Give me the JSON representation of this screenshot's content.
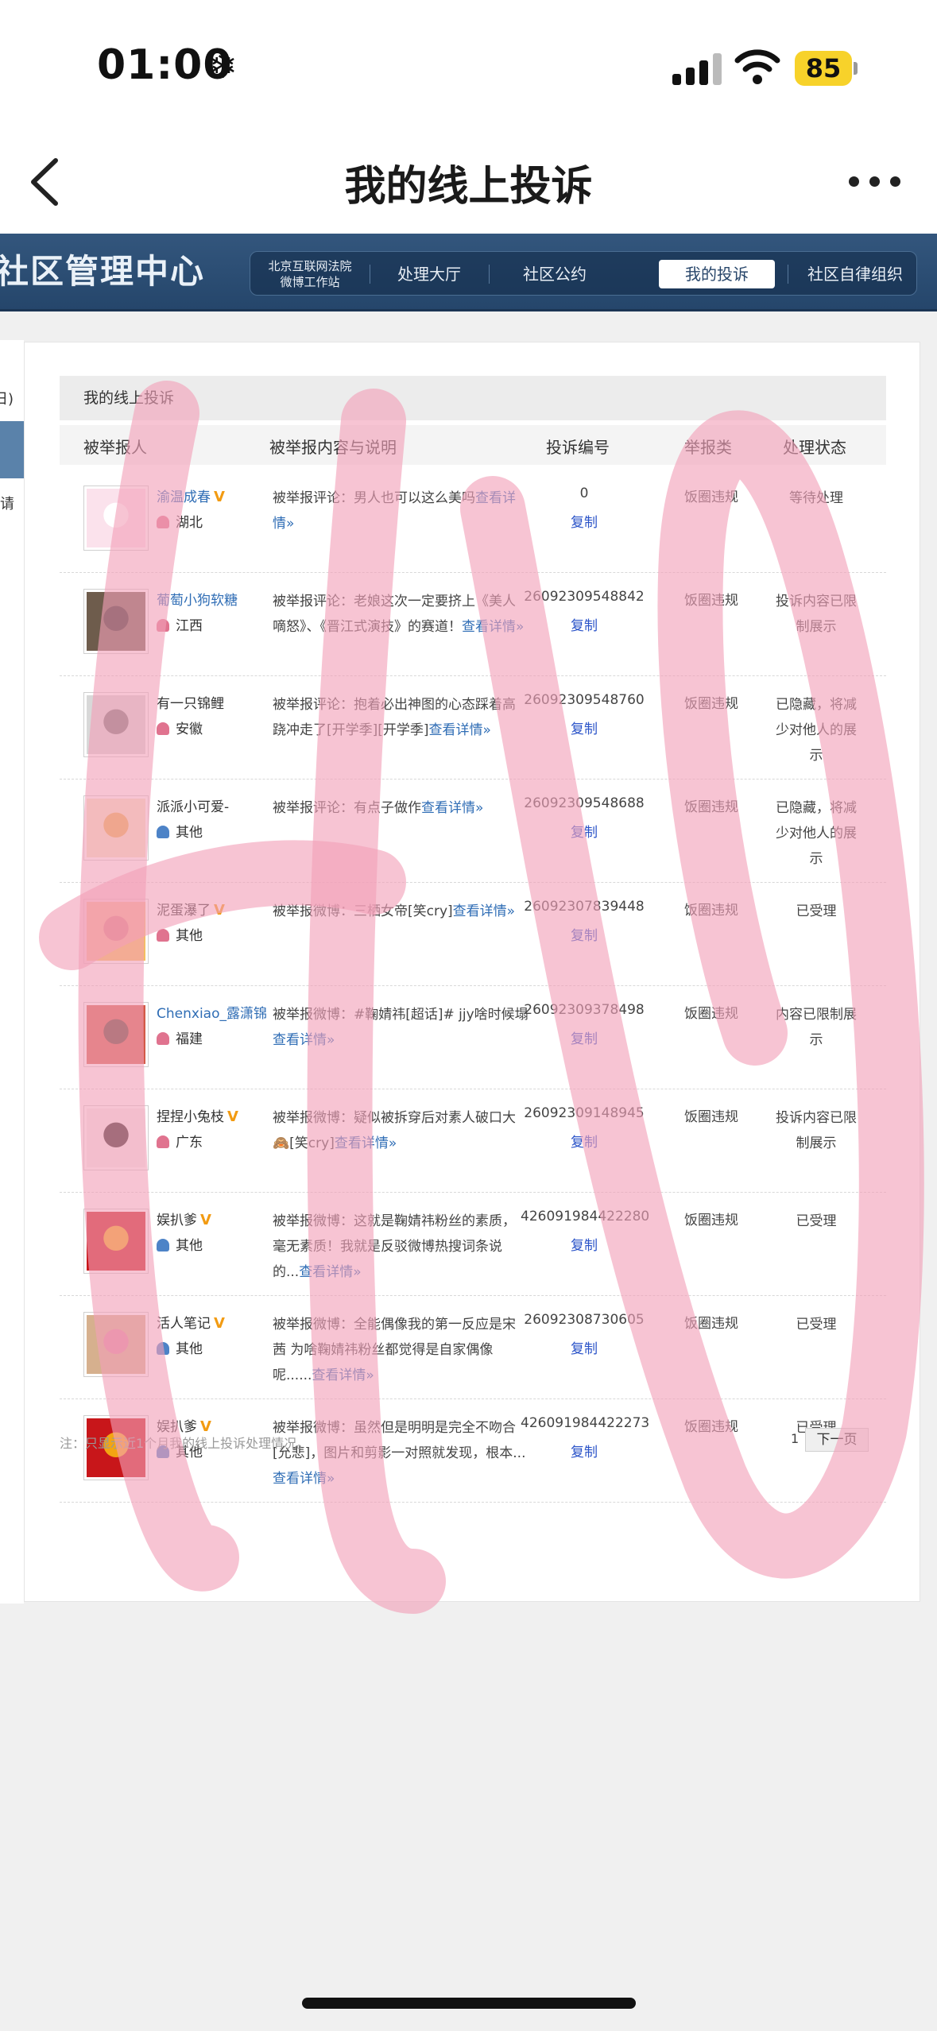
{
  "status": {
    "time": "01:00",
    "battery": "85"
  },
  "nav": {
    "title": "我的线上投诉"
  },
  "header": {
    "site_title": "社区管理中心",
    "tabs": [
      {
        "label_line1": "北京互联网法院",
        "label_line2": "微博工作站"
      },
      {
        "label": "处理大厅"
      },
      {
        "label": "社区公约"
      },
      {
        "label": "我的投诉"
      },
      {
        "label": "社区自律组织"
      }
    ]
  },
  "sidebar": {
    "item1": "日)",
    "item2": "请"
  },
  "panel": {
    "title": "我的线上投诉"
  },
  "table": {
    "headers": [
      "被举报人",
      "被举报内容与说明",
      "投诉编号",
      "举报类",
      "处理状态"
    ],
    "rows": [
      {
        "name": "渝温成春",
        "vip": true,
        "location": "湖北",
        "gender": "female",
        "desc_text": "被举报评论：男人也可以这么美吗",
        "desc_link": "查看详情»",
        "id": "0",
        "copy": "复制",
        "category": "饭圈违规",
        "status": "等待处理"
      },
      {
        "name": "葡萄小狗软糖",
        "vip": false,
        "location": "江西",
        "gender": "female",
        "desc_text": "被举报评论：老娘这次一定要挤上《美人嘀怒》、《晋江式演技》的赛道！",
        "desc_link": "查看详情»",
        "id": "26092309548842",
        "copy": "复制",
        "category": "饭圈违规",
        "status": "投诉内容已限制展示"
      },
      {
        "name": "有一只锦鲤",
        "vip": false,
        "location": "安徽",
        "gender": "female",
        "desc_text": "被举报评论：抱着必出神图的心态踩着高跷冲走了[开学季][开学季]",
        "desc_link": "查看详情»",
        "id": "26092309548760",
        "copy": "复制",
        "category": "饭圈违规",
        "status": "已隐藏，将减少对他人的展示"
      },
      {
        "name": "派派小可爱-",
        "vip": false,
        "location": "其他",
        "gender": "male",
        "desc_text": "被举报评论：有点子做作",
        "desc_link": "查看详情»",
        "id": "26092309548688",
        "copy": "复制",
        "category": "饭圈违规",
        "status": "已隐藏，将减少对他人的展示"
      },
      {
        "name": "泥蛋瀑了",
        "vip": true,
        "location": "其他",
        "gender": "female",
        "desc_text": "被举报微博：三栖女帝[笑cry]",
        "desc_link": "查看详情»",
        "id": "26092307839448",
        "copy": "复制",
        "category": "饭圈违规",
        "status": "已受理"
      },
      {
        "name": "Chenxiao_露潇锦",
        "vip": false,
        "location": "福建",
        "gender": "female",
        "desc_text": "被举报微博：#鞠婧祎[超话]# jjy啥时候塌",
        "desc_link": "查看详情»",
        "id": "26092309378498",
        "copy": "复制",
        "category": "饭圈违规",
        "status": "内容已限制展示"
      },
      {
        "name": "捏捏小兔枝",
        "vip": true,
        "location": "广东",
        "gender": "female",
        "desc_text": "被举报微博：疑似被拆穿后对素人破口大🙈[笑cry]",
        "desc_link": "查看详情»",
        "id": "26092309148945",
        "copy": "复制",
        "category": "饭圈违规",
        "status": "投诉内容已限制展示"
      },
      {
        "name": "娱扒爹",
        "vip": true,
        "location": "其他",
        "gender": "male",
        "desc_text": "被举报微博：这就是鞠婧祎粉丝的素质，毫无素质！我就是反驳微博热搜词条说的...",
        "desc_link": "查看详情»",
        "id": "426091984422280",
        "copy": "复制",
        "category": "饭圈违规",
        "status": "已受理"
      },
      {
        "name": "活人笔记",
        "vip": true,
        "location": "其他",
        "gender": "male",
        "desc_text": "被举报微博：全能偶像我的第一反应是宋茜 为啥鞠婧祎粉丝都觉得是自家偶像呢......",
        "desc_link": "查看详情»",
        "id": "26092308730605",
        "copy": "复制",
        "category": "饭圈违规",
        "status": "已受理"
      },
      {
        "name": "娱扒爹",
        "vip": true,
        "location": "其他",
        "gender": "male",
        "desc_text": "被举报微博：虽然但是明明是完全不吻合[允悲]，图片和剪影一对照就发现，根本...",
        "desc_link": "查看详情»",
        "id": "426091984422273",
        "copy": "复制",
        "category": "饭圈违规",
        "status": "已受理"
      }
    ]
  },
  "footer": {
    "note": "注：只显示近1个月我的线上投诉处理情况。",
    "page": "1",
    "next": "下一页"
  },
  "colors": {
    "header_blue": "#2c4d73",
    "link": "#2f6db5",
    "watermark": "#f2a0b8",
    "vip": "#f29b12"
  }
}
